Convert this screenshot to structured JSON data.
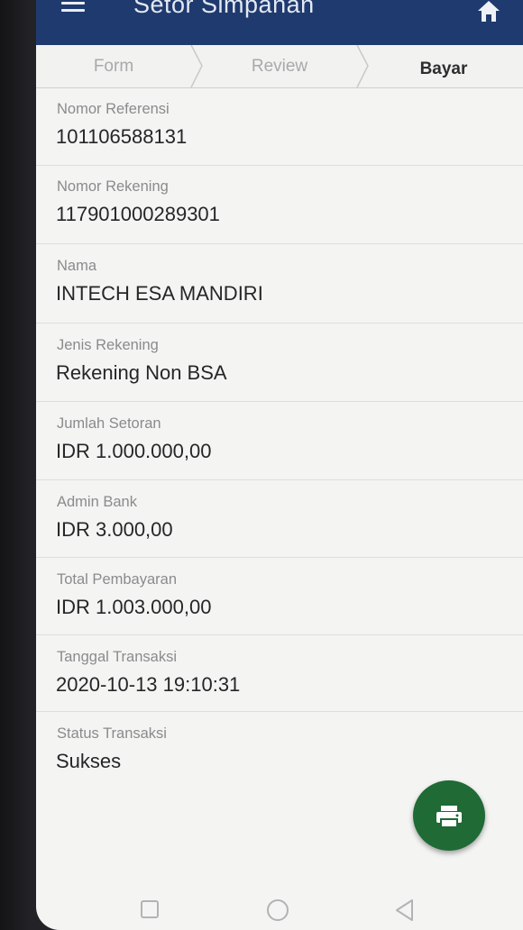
{
  "app_bar": {
    "title": "Setor Simpanan",
    "menu_icon": "hamburger-menu-icon",
    "home_icon": "home-icon",
    "color": "#1f3a6e"
  },
  "stepper": {
    "steps": [
      {
        "label": "Form",
        "state": "done"
      },
      {
        "label": "Review",
        "state": "done"
      },
      {
        "label": "Bayar",
        "state": "active"
      }
    ]
  },
  "details": [
    {
      "label": "Nomor Referensi",
      "value": "101106588131"
    },
    {
      "label": "Nomor Rekening",
      "value": "117901000289301"
    },
    {
      "label": "Nama",
      "value": "INTECH ESA MANDIRI"
    },
    {
      "label": "Jenis Rekening",
      "value": "Rekening Non BSA"
    },
    {
      "label": "Jumlah Setoran",
      "value": "IDR 1.000.000,00"
    },
    {
      "label": "Admin Bank",
      "value": "IDR 3.000,00"
    },
    {
      "label": "Total Pembayaran",
      "value": "IDR 1.003.000,00"
    },
    {
      "label": "Tanggal Transaksi",
      "value": "2020-10-13 19:10:31"
    },
    {
      "label": "Status Transaksi",
      "value": "Sukses"
    }
  ],
  "fab": {
    "icon": "print-icon",
    "color": "#1f6a35"
  },
  "system_nav": {
    "icons": [
      "recent-apps-icon",
      "home-circle-icon",
      "back-triangle-icon"
    ]
  }
}
